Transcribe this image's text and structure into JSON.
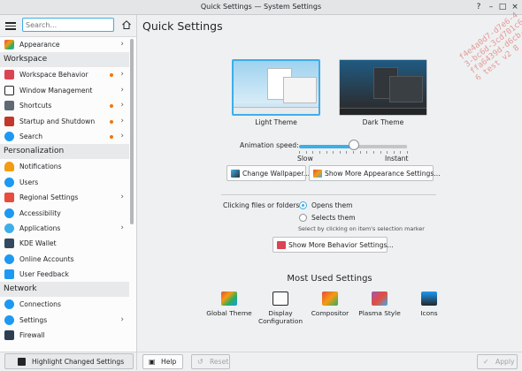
{
  "window": {
    "title": "Quick Settings — System Settings",
    "controls": [
      "?",
      "–",
      "□",
      "×"
    ]
  },
  "watermark": {
    "lines": [
      "f4e4a0d7-d7e6-4",
      "3-bc6d-3cd701c6 t",
      "ffa6439d-d6cb-4",
      "6 test v2 8 - f"
    ]
  },
  "sidebar": {
    "search_placeholder": "Search...",
    "items": [
      {
        "label": "Appearance",
        "arrow": true
      },
      {
        "category": "Workspace"
      },
      {
        "label": "Workspace Behavior",
        "arrow": true,
        "changed": true
      },
      {
        "label": "Window Management",
        "arrow": true
      },
      {
        "label": "Shortcuts",
        "arrow": true,
        "changed": true
      },
      {
        "label": "Startup and Shutdown",
        "arrow": true,
        "changed": true
      },
      {
        "label": "Search",
        "arrow": true,
        "changed": true
      },
      {
        "category": "Personalization"
      },
      {
        "label": "Notifications"
      },
      {
        "label": "Users"
      },
      {
        "label": "Regional Settings",
        "arrow": true
      },
      {
        "label": "Accessibility"
      },
      {
        "label": "Applications",
        "arrow": true
      },
      {
        "label": "KDE Wallet"
      },
      {
        "label": "Online Accounts"
      },
      {
        "label": "User Feedback"
      },
      {
        "category": "Network"
      },
      {
        "label": "Connections"
      },
      {
        "label": "Settings",
        "arrow": true
      },
      {
        "label": "Firewall"
      }
    ],
    "highlight_button": "Highlight Changed Settings"
  },
  "main": {
    "title": "Quick Settings",
    "themes": {
      "light_label": "Light Theme",
      "dark_label": "Dark Theme",
      "selected": "Light Theme"
    },
    "animation": {
      "label": "Animation speed:",
      "slow": "Slow",
      "instant": "Instant",
      "level": 0.5
    },
    "buttons": {
      "wallpaper": "Change Wallpaper...",
      "appearance": "Show More Appearance Settings...",
      "behavior": "Show More Behavior Settings..."
    },
    "clicking": {
      "label": "Clicking files or folders:",
      "option1": "Opens them",
      "option2": "Selects them",
      "selected": "Opens them",
      "hint": "Select by clicking on item's selection marker"
    },
    "most_used": {
      "title": "Most Used Settings",
      "items": [
        {
          "label": "Global Theme",
          "icon": "global-theme-icon"
        },
        {
          "label": "Display\nConfiguration",
          "icon": "display-icon"
        },
        {
          "label": "Compositor",
          "icon": "compositor-icon"
        },
        {
          "label": "Plasma Style",
          "icon": "plasma-style-icon"
        },
        {
          "label": "Icons",
          "icon": "icons-icon"
        }
      ]
    },
    "footer": {
      "help": "Help",
      "reset": "Reset",
      "apply": "Apply"
    }
  },
  "colors": {
    "accent": "#3daee9",
    "changed_dot": "#f67400"
  }
}
